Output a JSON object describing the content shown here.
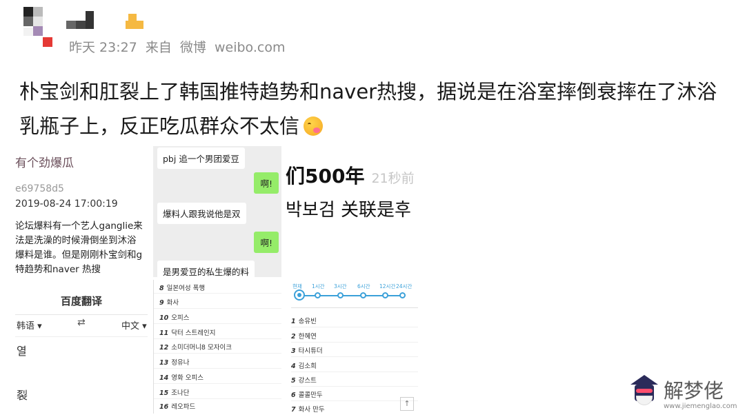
{
  "header": {
    "timestamp": "昨天 23:27",
    "source_prefix": "来自",
    "source_app": "微博",
    "source_domain": "weibo.com"
  },
  "post": {
    "text": "朴宝剑和肛裂上了韩国推特趋势和naver热搜，据说是在浴室摔倒衰摔在了沐浴乳瓶子上，反正吃瓜群众不太信",
    "emoji": "drooling-face-emoji"
  },
  "images": {
    "forum": {
      "title": "有个劲爆瓜",
      "id": "e69758d5",
      "datetime": "2019-08-24 17:00:19",
      "lines": [
        "论坛爆料有一个艺人ganglie来",
        "法是洗澡的时候滑倒坐到沐浴",
        "爆料是谁。但是刚刚朴宝剑和g",
        "特趋势和naver 热搜"
      ]
    },
    "chat": {
      "messages": [
        {
          "side": "left",
          "text": "pbj 追一个男团爱豆"
        },
        {
          "side": "right",
          "text": "啊!"
        },
        {
          "side": "left",
          "text": "爆料人跟我说他是双"
        },
        {
          "side": "right",
          "text": "啊!"
        },
        {
          "side": "left",
          "text": "是男爱豆的私生爆的料"
        }
      ]
    },
    "trend": {
      "headline": "们500年",
      "ago": "21秒前",
      "korean": "박보검 关联是후"
    },
    "translate": {
      "app_title": "百度翻译",
      "source_lang": "韩语",
      "swap_symbol": "⇄",
      "target_lang": "中文",
      "source_text": "열",
      "result_text": "裂"
    },
    "ranking_left": {
      "rows": [
        {
          "rank": "8",
          "name": "일본여성 폭행"
        },
        {
          "rank": "9",
          "name": "화사"
        },
        {
          "rank": "10",
          "name": "오피스"
        },
        {
          "rank": "11",
          "name": "닥터 스트레인지"
        },
        {
          "rank": "12",
          "name": "소미더머니8 모자이크"
        },
        {
          "rank": "13",
          "name": "정유나"
        },
        {
          "rank": "14",
          "name": "영화 오피스"
        },
        {
          "rank": "15",
          "name": "조나단"
        },
        {
          "rank": "16",
          "name": "레오파드"
        }
      ]
    },
    "ranking_right": {
      "timeline_labels": [
        "현재",
        "1시간",
        "3시간",
        "6시간",
        "12시간",
        "24시간"
      ],
      "rows": [
        {
          "rank": "1",
          "name": "송유빈"
        },
        {
          "rank": "2",
          "name": "한혜연"
        },
        {
          "rank": "3",
          "name": "타시튜더"
        },
        {
          "rank": "4",
          "name": "김소희"
        },
        {
          "rank": "5",
          "name": "강스트"
        },
        {
          "rank": "6",
          "name": "콜콜만두"
        },
        {
          "rank": "7",
          "name": "화사 만두"
        }
      ],
      "up_button": "↑"
    }
  },
  "watermark": {
    "text": "解梦佬",
    "url": "www.jiemenglao.com"
  },
  "colors": {
    "meta_gray": "#8a8a8a",
    "wechat_green": "#95ec69",
    "timeline_blue": "#3aa0d9"
  }
}
